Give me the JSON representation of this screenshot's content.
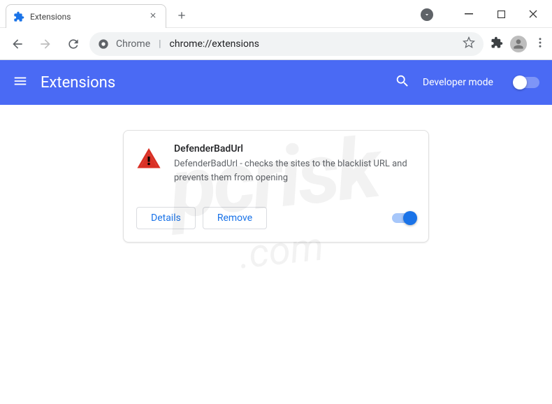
{
  "window": {
    "tab_title": "Extensions"
  },
  "omnibox": {
    "prefix": "Chrome",
    "path": "chrome://extensions"
  },
  "header": {
    "title": "Extensions",
    "dev_mode_label": "Developer mode"
  },
  "extension": {
    "name": "DefenderBadUrl",
    "description": "DefenderBadUrl - checks the sites to the blacklist URL and prevents them from opening",
    "details_label": "Details",
    "remove_label": "Remove",
    "enabled": true
  }
}
